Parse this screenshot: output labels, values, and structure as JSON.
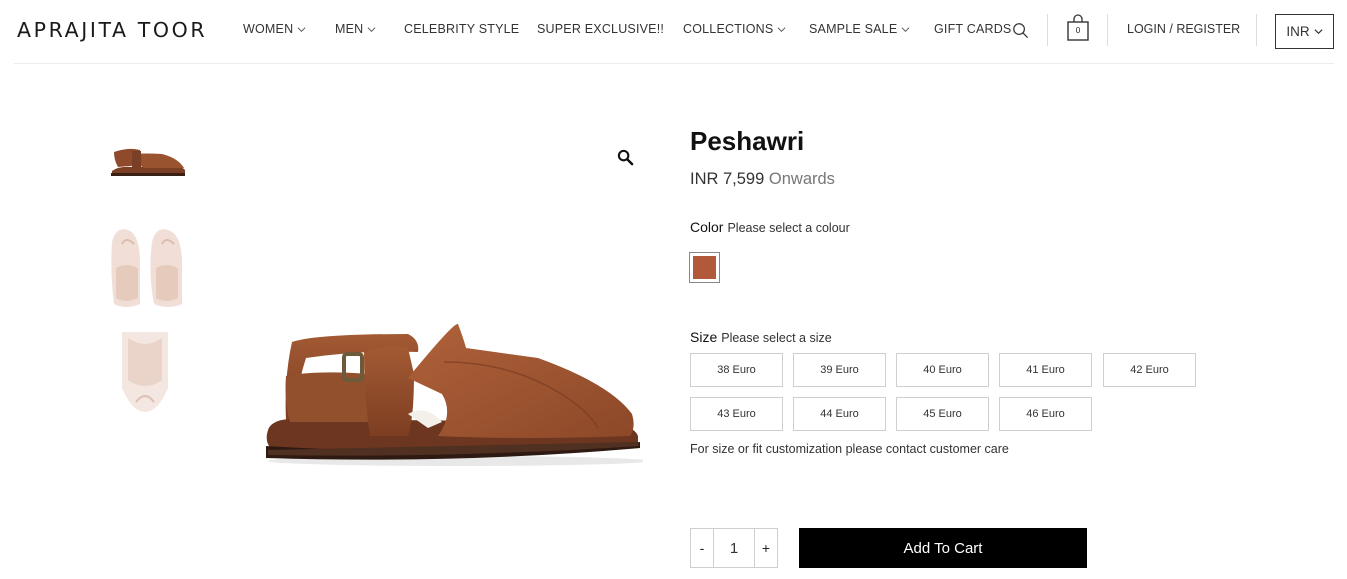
{
  "brand": {
    "logo_text": "APRAJITA TOOR"
  },
  "nav": {
    "items": [
      {
        "label": "WOMEN",
        "dropdown": true
      },
      {
        "label": "MEN",
        "dropdown": true
      },
      {
        "label": "CELEBRITY STYLE",
        "dropdown": false
      },
      {
        "label": "SUPER EXCLUSIVE!!",
        "dropdown": false
      },
      {
        "label": "COLLECTIONS",
        "dropdown": true
      },
      {
        "label": "SAMPLE SALE",
        "dropdown": true
      },
      {
        "label": "GIFT CARDS",
        "dropdown": false
      }
    ],
    "cart_count": "0",
    "login_label": "LOGIN / REGISTER",
    "currency": "INR"
  },
  "product": {
    "title": "Peshawri",
    "price": "INR 7,599",
    "price_suffix": "Onwards",
    "color_label": "Color",
    "color_hint": "Please select a colour",
    "colors": [
      "#b3593b"
    ],
    "size_label": "Size",
    "size_hint": "Please select a size",
    "sizes": [
      "38 Euro",
      "39 Euro",
      "40 Euro",
      "41 Euro",
      "42 Euro",
      "43 Euro",
      "44 Euro",
      "45 Euro",
      "46 Euro"
    ],
    "size_note": "For size or fit customization please contact customer care",
    "quantity": "1",
    "qty_minus": "-",
    "qty_plus": "+",
    "add_to_cart": "Add To Cart"
  },
  "icons": {
    "search": "search-icon",
    "cart": "shopping-bag-icon",
    "zoom": "magnifier-icon",
    "chevron": "chevron-down-icon"
  },
  "theme": {
    "accent": "#000000",
    "leather": "#8a4a2b"
  }
}
